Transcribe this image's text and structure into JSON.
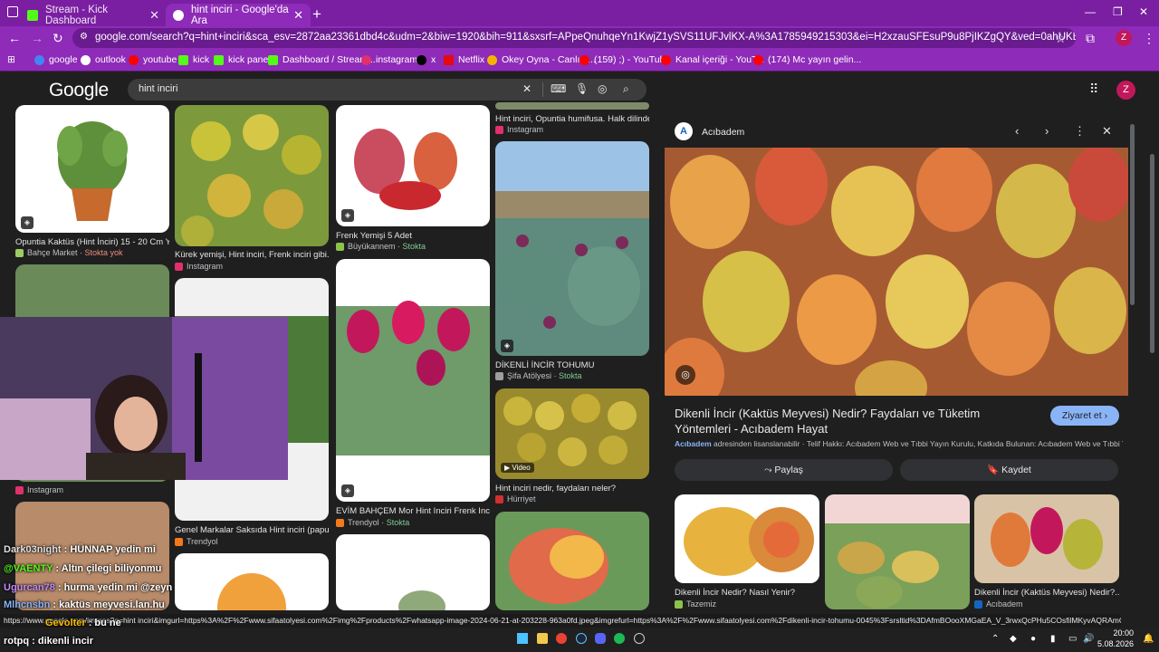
{
  "tabs": [
    {
      "title": "Stream - Kick Dashboard",
      "active": false
    },
    {
      "title": "hint inciri - Google'da Ara",
      "active": true
    }
  ],
  "url": "google.com/search?q=hint+inciri&sca_esv=2872aa23361dbd4c&udm=2&biw=1920&bih=911&sxsrf=APpeQnuhqeYn1KwjZ1ySVS11UFJvlKX-A%3A1785949215303&ei=H2xzauSFEsuP9u8PjIKZgQY&ved=0ahUKEwikkcKk-4mWAxXLh_0HHQxBJmAQ4dUD...",
  "bookmarks": [
    {
      "label": "google",
      "color": "#4285f4"
    },
    {
      "label": "outlook",
      "color": "#ffffff"
    },
    {
      "label": "youtube",
      "color": "#ff0000"
    },
    {
      "label": "kick",
      "color": "#53fc18"
    },
    {
      "label": "kick panel",
      "color": "#53fc18"
    },
    {
      "label": "Dashboard / Stream...",
      "color": "#53fc18"
    },
    {
      "label": "instagram",
      "color": "#e1306c"
    },
    {
      "label": "x",
      "color": "#000000"
    },
    {
      "label": "Netflix",
      "color": "#e50914"
    },
    {
      "label": "Okey Oyna - Canlı 1...",
      "color": "#f4b400"
    },
    {
      "label": "(159) ;) - YouTube",
      "color": "#ff0000"
    },
    {
      "label": "Kanal içeriği - YouT...",
      "color": "#ff0000"
    },
    {
      "label": "(174) Mc yayın gelin...",
      "color": "#ff0000"
    }
  ],
  "google": {
    "logo": "Google",
    "query": "hint inciri",
    "avatar": "Z"
  },
  "results": [
    {
      "title": "Opuntia Kaktüs (Hint İnciri) 15 - 20 Cm Yeşil",
      "source": "Bahçe Market",
      "stock": "Stokta yok"
    },
    {
      "title": "Kürek yemişi, Hint inciri, Frenk inciri gibi...",
      "source": "Instagram",
      "stock": ""
    },
    {
      "title": "Frenk Yemişi 5 Adet",
      "source": "Büyükannem",
      "stock": "Stokta"
    },
    {
      "title": "Hint inciri, Opuntia humifusa. Halk dilinde...",
      "source": "Instagram",
      "stock": ""
    },
    {
      "title": "DİKENLİ İNCİR TOHUMU",
      "source": "Şifa Atölyesi",
      "stock": "Stokta"
    },
    {
      "title": "Hint inciri nedir, faydaları neler?",
      "source": "Hürriyet",
      "stock": ""
    },
    {
      "title": "Genel Markalar Saksıda Hint inciri (papuç...",
      "source": "Trendyol",
      "stock": ""
    },
    {
      "title": "EVİM BAHÇEM Mor Hint Inciri Frenk Inciri...",
      "source": "Trendyol",
      "stock": "Stokta"
    },
    {
      "title": "",
      "source": "Instagram",
      "stock": ""
    }
  ],
  "video_label": "Video",
  "panel": {
    "site": "Acıbadem",
    "title": "Dikenli İncir (Kaktüs Meyvesi) Nedir? Faydaları ve Tüketim Yöntemleri - Acıbadem Hayat",
    "visit": "Ziyaret et",
    "license_src": "Acıbadem",
    "license_text": "adresinden lisanslanabilir · Telif Hakkı: Acıbadem Web ve Tıbbi Yayın Kurulu, Katkıda Bulunan: Acıbadem Web ve Tıbbi Yayı...",
    "share": "Paylaş",
    "save": "Kaydet",
    "related": [
      {
        "title": "Dikenli İncir Nedir? Nasıl Yenir?",
        "source": "Tazemiz"
      },
      {
        "title": "",
        "source": ""
      },
      {
        "title": "Dikenli İncir (Kaktüs Meyvesi) Nedir?...",
        "source": "Acıbadem"
      }
    ]
  },
  "status_url": "https://www.google.com/imgres?q=hint inciri&imgurl=https%3A%2F%2Fwww.sifaatolyesi.com%2Fimg%2Fproducts%2Fwhatsapp-image-2024-06-21-at-203228-963a0fd.jpeg&imgrefurl=https%3A%2F%2Fwww.sifaatolyesi.com%2Fdikenli-incir-tohumu-0045%3Fsrsltid%3DAfmBOooXMGaEA_V_3rwxQcPHu5COsfilMKyvAQRAmOVQfLhoq1xGpPZ8&docid=...",
  "chat": [
    {
      "user": "Dark03night",
      "msg": ": HÜNNAP yedin mi",
      "color": "#e0e0e0"
    },
    {
      "user": "@VAENTY",
      "msg": ": Altın çilegi biliyonmu",
      "color": "#53fc18"
    },
    {
      "user": "Ugurcan78",
      "msg": ": hurma yedin mi @zeyn",
      "color": "#c58af9"
    },
    {
      "user": "Mlhcnsbn",
      "msg": ": kaktüs meyvesi.lan.hu",
      "color": "#8ab4f8"
    },
    {
      "user": "Gevolter",
      "msg": ": bu ne",
      "color": "#fbbc04"
    },
    {
      "user": "rotpq",
      "msg": ": dikenli incir",
      "color": "#ffffff"
    }
  ],
  "clock": {
    "time": "20:00",
    "date": "5.08.2026"
  }
}
